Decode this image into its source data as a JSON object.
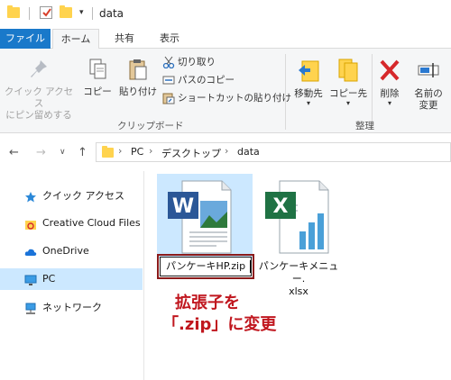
{
  "window": {
    "title": "data"
  },
  "tabs": {
    "file": "ファイル",
    "home": "ホーム",
    "share": "共有",
    "view": "表示"
  },
  "ribbon": {
    "pin": "クイック アクセス\nにピン留めする",
    "copy": "コピー",
    "paste": "貼り付け",
    "cut": "切り取り",
    "copy_path": "パスのコピー",
    "paste_shortcut": "ショートカットの貼り付け",
    "clipboard_group": "クリップボード",
    "move_to": "移動先",
    "copy_to": "コピー先",
    "delete": "削除",
    "rename": "名前の\n変更",
    "organize_group": "整理"
  },
  "address": {
    "crumbs": [
      "PC",
      "デスクトップ",
      "data"
    ]
  },
  "sidebar": {
    "items": [
      {
        "label": "クイック アクセス",
        "icon": "star-icon"
      },
      {
        "label": "Creative Cloud Files",
        "icon": "creative-cloud-icon"
      },
      {
        "label": "OneDrive",
        "icon": "cloud-icon"
      },
      {
        "label": "PC",
        "icon": "monitor-icon",
        "selected": true
      },
      {
        "label": "ネットワーク",
        "icon": "network-icon"
      }
    ]
  },
  "files": {
    "word_rename_value": "パンケーキHP.zip",
    "excel_name": "パンケーキメニュー.\nxlsx"
  },
  "annotation": {
    "line1": "拡張子を",
    "line2": "「.zip」に変更"
  },
  "colors": {
    "accent": "#1979ca",
    "highlight": "#cce8ff",
    "annotation": "#c0161e",
    "folder": "#ffd34e"
  }
}
